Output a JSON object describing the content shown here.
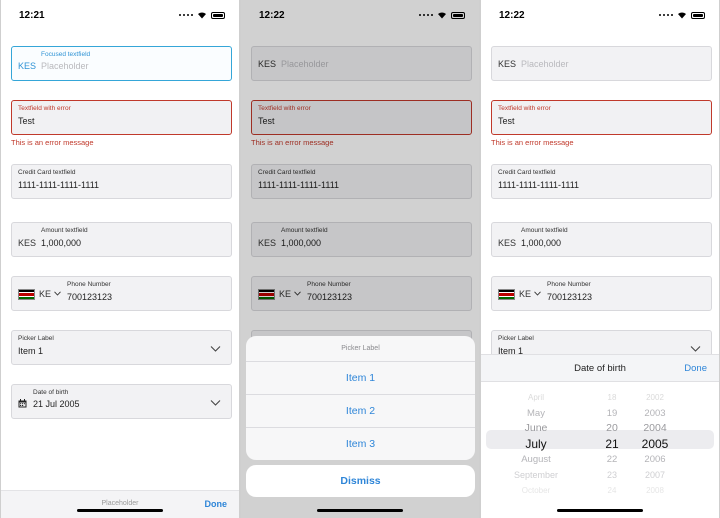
{
  "screens": [
    {
      "time": "12:21",
      "focused_field": {
        "prefix": "KES",
        "label": "Focused textfield",
        "placeholder": "Placeholder"
      },
      "error_field": {
        "label": "Textfield with error",
        "value": "Test",
        "error": "This is an error message"
      },
      "credit_card": {
        "label": "Credit Card textfield",
        "value": "1111-1111-1111-1111"
      },
      "amount": {
        "label": "Amount textfield",
        "prefix": "KES",
        "value": "1,000,000"
      },
      "phone": {
        "country": "KE",
        "label": "Phone Number",
        "value": "700123123"
      },
      "picker": {
        "label": "Picker Label",
        "value": "Item 1"
      },
      "dob": {
        "label": "Date of birth",
        "value": "21 Jul 2005"
      },
      "accessory": {
        "placeholder": "Placeholder",
        "done": "Done"
      }
    },
    {
      "time": "12:22",
      "top_field": {
        "prefix": "KES",
        "placeholder": "Placeholder"
      },
      "error_field": {
        "label": "Textfield with error",
        "value": "Test",
        "error": "This is an error message"
      },
      "credit_card": {
        "label": "Credit Card textfield",
        "value": "1111-1111-1111-1111"
      },
      "amount": {
        "label": "Amount textfield",
        "prefix": "KES",
        "value": "1,000,000"
      },
      "phone": {
        "country": "KE",
        "label": "Phone Number",
        "value": "700123123"
      },
      "action_sheet": {
        "title": "Picker Label",
        "options": [
          "Item 1",
          "Item 2",
          "Item 3"
        ],
        "dismiss": "Dismiss"
      }
    },
    {
      "time": "12:22",
      "top_field": {
        "prefix": "KES",
        "placeholder": "Placeholder"
      },
      "error_field": {
        "label": "Textfield with error",
        "value": "Test",
        "error": "This is an error message"
      },
      "credit_card": {
        "label": "Credit Card textfield",
        "value": "1111-1111-1111-1111"
      },
      "amount": {
        "label": "Amount textfield",
        "prefix": "KES",
        "value": "1,000,000"
      },
      "phone": {
        "country": "KE",
        "label": "Phone Number",
        "value": "700123123"
      },
      "picker": {
        "label": "Picker Label",
        "value": "Item 1"
      },
      "date_picker": {
        "title": "Date of birth",
        "done": "Done",
        "months": [
          "April",
          "May",
          "June",
          "July",
          "August",
          "September",
          "October"
        ],
        "days": [
          "18",
          "19",
          "20",
          "21",
          "22",
          "23",
          "24"
        ],
        "years": [
          "2002",
          "2003",
          "2004",
          "2005",
          "2006",
          "2007",
          "2008"
        ]
      }
    }
  ],
  "colors": {
    "accent": "#2f86d8",
    "focus": "#35a6d8",
    "error": "#c0392b"
  },
  "icons": [
    "wifi-icon",
    "battery-icon",
    "chevron-down-icon",
    "calendar-icon",
    "kenya-flag-icon"
  ]
}
